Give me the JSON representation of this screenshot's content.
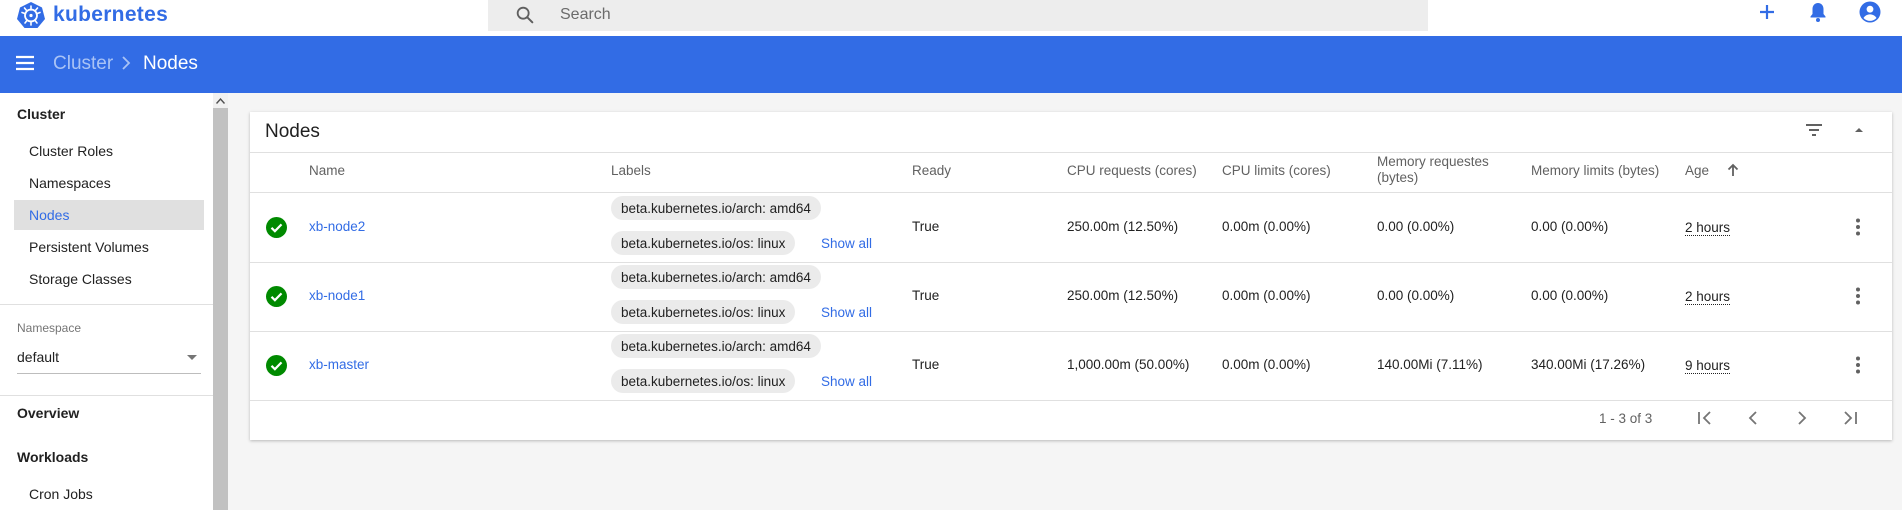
{
  "app": {
    "logo_text": "kubernetes"
  },
  "search": {
    "placeholder": "Search",
    "value": ""
  },
  "topbar": {
    "icons": [
      "add-icon",
      "notifications-icon",
      "account-icon"
    ]
  },
  "breadcrumb": {
    "parent": "Cluster",
    "current": "Nodes"
  },
  "sidebar": {
    "cluster_heading": "Cluster",
    "cluster_items": [
      {
        "label": "Cluster Roles"
      },
      {
        "label": "Namespaces"
      },
      {
        "label": "Nodes",
        "active": true
      },
      {
        "label": "Persistent Volumes"
      },
      {
        "label": "Storage Classes"
      }
    ],
    "namespace_label": "Namespace",
    "namespace_value": "default",
    "overview_heading": "Overview",
    "workloads_heading": "Workloads",
    "workloads_items": [
      {
        "label": "Cron Jobs"
      }
    ]
  },
  "nodes_card": {
    "title": "Nodes",
    "columns": {
      "name": "Name",
      "labels": "Labels",
      "ready": "Ready",
      "cpu_requests": "CPU requests (cores)",
      "cpu_limits": "CPU limits (cores)",
      "memory_requests_line1": "Memory requestes",
      "memory_requests_line2": "(bytes)",
      "memory_limits": "Memory limits (bytes)",
      "age": "Age"
    },
    "rows": [
      {
        "status": "ok",
        "name": "xb-node2",
        "labels": [
          "beta.kubernetes.io/arch: amd64",
          "beta.kubernetes.io/os: linux"
        ],
        "show_all": "Show all",
        "ready": "True",
        "cpu_requests": "250.00m (12.50%)",
        "cpu_limits": "0.00m (0.00%)",
        "memory_requests": "0.00 (0.00%)",
        "memory_limits": "0.00 (0.00%)",
        "age": "2 hours"
      },
      {
        "status": "ok",
        "name": "xb-node1",
        "labels": [
          "beta.kubernetes.io/arch: amd64",
          "beta.kubernetes.io/os: linux"
        ],
        "show_all": "Show all",
        "ready": "True",
        "cpu_requests": "250.00m (12.50%)",
        "cpu_limits": "0.00m (0.00%)",
        "memory_requests": "0.00 (0.00%)",
        "memory_limits": "0.00 (0.00%)",
        "age": "2 hours"
      },
      {
        "status": "ok",
        "name": "xb-master",
        "labels": [
          "beta.kubernetes.io/arch: amd64",
          "beta.kubernetes.io/os: linux"
        ],
        "show_all": "Show all",
        "ready": "True",
        "cpu_requests": "1,000.00m (50.00%)",
        "cpu_limits": "0.00m (0.00%)",
        "memory_requests": "140.00Mi (7.11%)",
        "memory_limits": "340.00Mi (17.26%)",
        "age": "9 hours"
      }
    ],
    "pagination": {
      "range_text": "1 - 3 of 3"
    }
  },
  "colors": {
    "brand_blue": "#326ce5",
    "success_green": "#008a00",
    "active_item_bg": "#e0e0e0"
  }
}
